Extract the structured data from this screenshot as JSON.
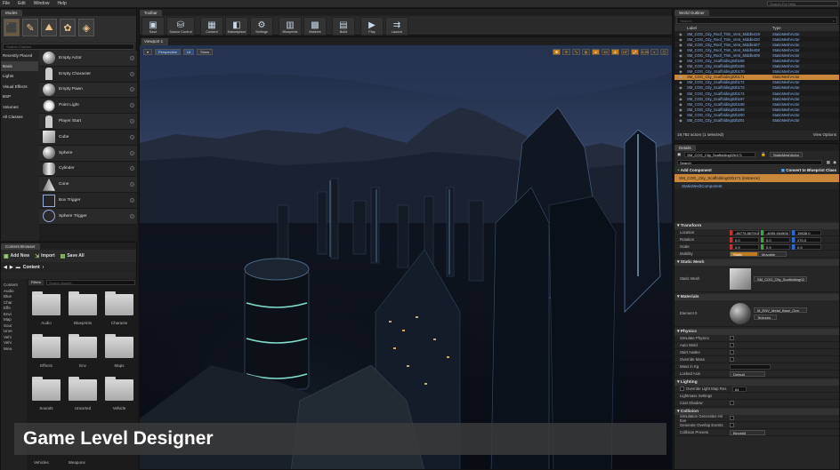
{
  "menu": [
    "File",
    "Edit",
    "Window",
    "Help"
  ],
  "search_help_placeholder": "Search For Help",
  "modes": {
    "tab": "Modes",
    "search_placeholder": "Search Classes",
    "categories": [
      "Recently Placed",
      "Basic",
      "Lights",
      "Visual Effects",
      "BSP",
      "Volumes",
      "All Classes"
    ],
    "selected_category": "Basic",
    "items": [
      "Empty Actor",
      "Empty Character",
      "Empty Pawn",
      "Point Light",
      "Player Start",
      "Cube",
      "Sphere",
      "Cylinder",
      "Cone",
      "Box Trigger",
      "Sphere Trigger"
    ]
  },
  "content_browser": {
    "tab": "Content Browser",
    "add_new": "Add New",
    "import": "Import",
    "save_all": "Save All",
    "path": "Content",
    "filters": "Filters",
    "search_placeholder": "Search Assets",
    "tree": [
      "Content",
      "Audio",
      "Blue",
      "Char",
      "Effe",
      "Envi",
      "Map",
      "Sour",
      "Unre",
      "Vehi",
      "Vehi",
      "Wea"
    ],
    "folders": [
      "Audio",
      "Blueprints",
      "Characte",
      "Effects",
      "Env",
      "Maps",
      "Sounds",
      "Unsorted",
      "Vehicle"
    ],
    "bottom_labels": [
      "Vehicles",
      "Weapons"
    ]
  },
  "toolbar": {
    "tab": "Toolbar",
    "buttons": [
      "Save",
      "Source Control",
      "Content",
      "Marketplace",
      "Settings",
      "Blueprints",
      "Matinee",
      "Build",
      "Play",
      "Launch"
    ]
  },
  "viewport": {
    "tab": "Viewport 1",
    "perspective": "Perspective",
    "lit": "Lit",
    "show": "Show",
    "snap_values": [
      "10",
      "10°",
      "0.25"
    ]
  },
  "banner": "Game Level Designer",
  "outliner": {
    "tab": "World Outliner",
    "search_placeholder": "Search...",
    "col_label": "Label",
    "col_type": "Type",
    "rows": [
      "SM_COG_City_Roof_Trim_Vent_Middle419",
      "SM_COG_City_Roof_Trim_Vent_Middle420",
      "SM_COG_City_Roof_Trim_Vent_Middle407",
      "SM_COG_City_Roof_Trim_Vent_Middle408",
      "SM_COG_City_Roof_Trim_Vent_Middle409",
      "SM_COG_City_Scaffolding02b168",
      "SM_COG_City_Scaffolding02b169",
      "SM_COG_City_Scaffolding02b170",
      "SM_COG_City_Scaffolding02b171",
      "SM_COG_City_Scaffolding02b172",
      "SM_COG_City_Scaffolding02b173",
      "SM_COG_City_Scaffolding02b174",
      "SM_COG_City_Scaffolding02b197",
      "SM_COG_City_Scaffolding02b198",
      "SM_COG_City_Scaffolding02b199",
      "SM_COG_City_Scaffolding02b200",
      "SM_COG_City_Scaffolding02b201"
    ],
    "row_type": "StaticMeshActor",
    "selected_index": 8,
    "count": "19,782 actors (1 selected)",
    "view_options": "View Options"
  },
  "details": {
    "tab": "Details",
    "name": "SM_COG_City_Scaffolding02b171",
    "mesh_class": "StaticMeshActor",
    "search_placeholder": "Search",
    "add_component": "Add Component",
    "blueprint": "Convert to Blueprint Class",
    "instance": "SM_COG_City_Scaffolding02b171 (Instance)",
    "component": "StaticMeshComponent",
    "transform": "Transform",
    "location": "Location",
    "rotation": "Rotation",
    "scale": "Scale",
    "mobility": "Mobility",
    "loc": [
      "-46775.867910",
      "-4059.464508",
      "15638.0"
    ],
    "rot": [
      "0.0",
      "0.0",
      "270.0"
    ],
    "scl": [
      "0.9",
      "0.9",
      "0.9"
    ],
    "mobility_static": "Static",
    "mobility_movable": "Movable",
    "static_mesh_sect": "Static Mesh",
    "static_mesh_label": "Static Mesh",
    "static_mesh_value": "SM_COG_City_Scaffolding02",
    "materials": "Materials",
    "element": "Element 0",
    "material_value": "M_ENV_Metal_Base_Gen",
    "textures": "Textures",
    "physics": "Physics",
    "physics_props": [
      "Simulate Physics",
      "Auto Weld",
      "Start Awake",
      "Override Mass",
      "Mass in Kg",
      "Locked Axis"
    ],
    "locked_axis_value": "Default",
    "lighting": "Lighting",
    "lighting_props": [
      "Override Light Map Res",
      "Lightmass Settings",
      "Cast Shadow"
    ],
    "lightmap_value": "64",
    "collision": "Collision",
    "collision_props": [
      "Simulation Generates Hit Eve",
      "Generate Overlap Events",
      "Collision Presets"
    ],
    "collision_preset_value": "BlockAll"
  }
}
